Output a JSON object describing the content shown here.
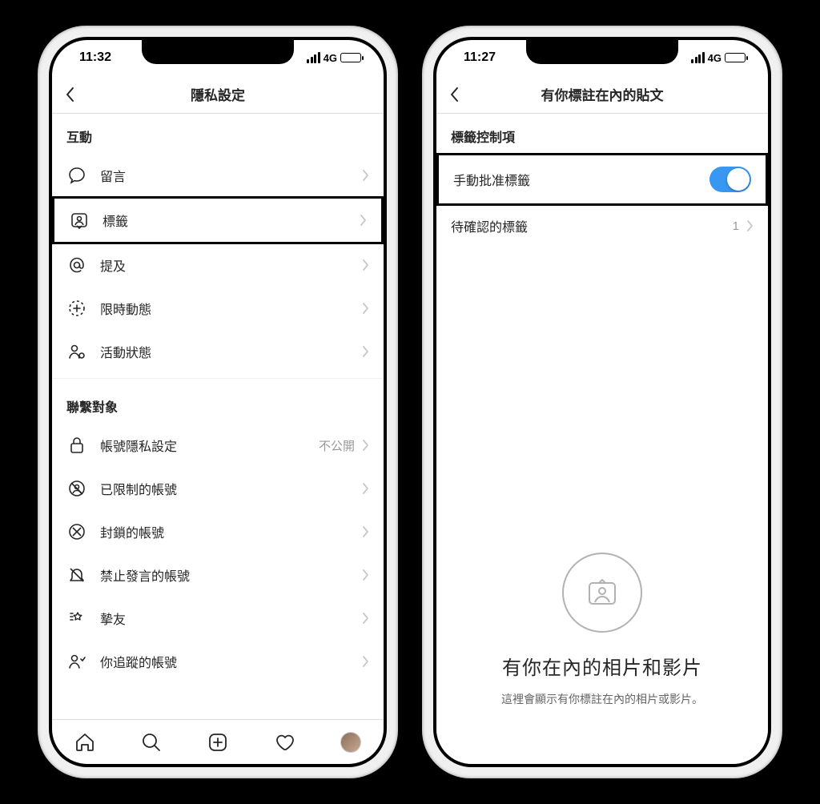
{
  "left": {
    "status": {
      "time": "11:32",
      "network": "4G"
    },
    "nav": {
      "title": "隱私設定"
    },
    "sections": {
      "interactions_header": "互動",
      "connections_header": "聯繫對象"
    },
    "rows": {
      "comments": "留言",
      "tags": "標籤",
      "mentions": "提及",
      "story": "限時動態",
      "activity": "活動狀態",
      "privacy": "帳號隱私設定",
      "privacy_value": "不公開",
      "restricted": "已限制的帳號",
      "blocked": "封鎖的帳號",
      "muted": "禁止發言的帳號",
      "close_friends": "摯友",
      "following": "你追蹤的帳號"
    }
  },
  "right": {
    "status": {
      "time": "11:27",
      "network": "4G"
    },
    "nav": {
      "title": "有你標註在內的貼文"
    },
    "section_header": "標籤控制項",
    "rows": {
      "manual_approve": "手動批准標籤",
      "pending": "待確認的標籤",
      "pending_count": "1"
    },
    "empty": {
      "title": "有你在內的相片和影片",
      "sub": "這裡會顯示有你標註在內的相片或影片。"
    }
  }
}
